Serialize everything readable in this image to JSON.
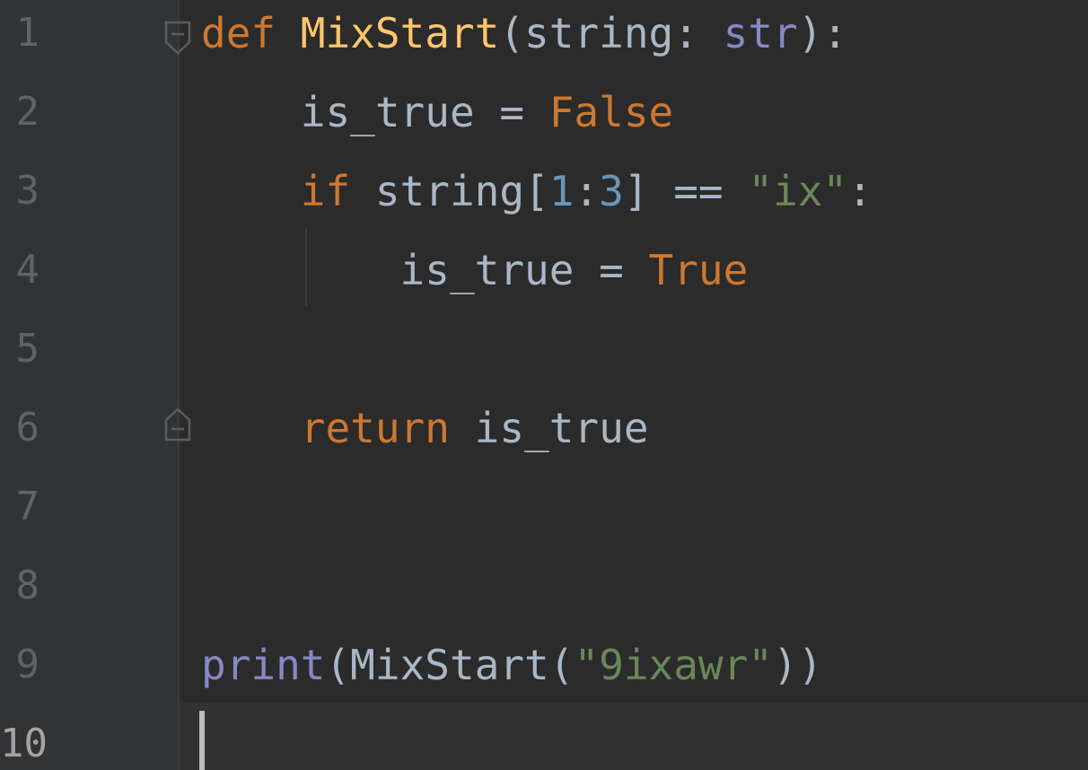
{
  "editor": {
    "language": "python",
    "line_numbers": [
      "1",
      "2",
      "3",
      "4",
      "5",
      "6",
      "7",
      "8",
      "9",
      "10"
    ],
    "active_line": 10,
    "lines": [
      [
        {
          "t": "def",
          "c": "kw"
        },
        {
          "t": " ",
          "c": "plain"
        },
        {
          "t": "MixStart",
          "c": "fn"
        },
        {
          "t": "(string: ",
          "c": "plain"
        },
        {
          "t": "str",
          "c": "builtin"
        },
        {
          "t": "):",
          "c": "plain"
        }
      ],
      [
        {
          "t": "    is_true = ",
          "c": "plain"
        },
        {
          "t": "False",
          "c": "kw"
        }
      ],
      [
        {
          "t": "    ",
          "c": "plain"
        },
        {
          "t": "if",
          "c": "kw"
        },
        {
          "t": " string[",
          "c": "plain"
        },
        {
          "t": "1",
          "c": "num"
        },
        {
          "t": ":",
          "c": "plain"
        },
        {
          "t": "3",
          "c": "num"
        },
        {
          "t": "] == ",
          "c": "plain"
        },
        {
          "t": "\"ix\"",
          "c": "str"
        },
        {
          "t": ":",
          "c": "plain"
        }
      ],
      [
        {
          "t": "        is_true = ",
          "c": "plain"
        },
        {
          "t": "True",
          "c": "kw"
        }
      ],
      [],
      [
        {
          "t": "    ",
          "c": "plain"
        },
        {
          "t": "return",
          "c": "kw"
        },
        {
          "t": " is_true",
          "c": "plain"
        }
      ],
      [],
      [],
      [
        {
          "t": "print",
          "c": "builtin"
        },
        {
          "t": "(MixStart(",
          "c": "plain"
        },
        {
          "t": "\"9ixawr\"",
          "c": "str"
        },
        {
          "t": "))",
          "c": "plain"
        }
      ],
      []
    ]
  },
  "colors": {
    "background": "#2b2b2b",
    "gutter": "#313335",
    "keyword": "#cc7832",
    "function": "#ffc66d",
    "builtin": "#8888c6",
    "number": "#6897bb",
    "string": "#6a8759",
    "text": "#a9b7c6",
    "line_number": "#606366"
  },
  "icons": {
    "fold_start": "fold-collapse-icon",
    "fold_end": "fold-end-icon"
  }
}
